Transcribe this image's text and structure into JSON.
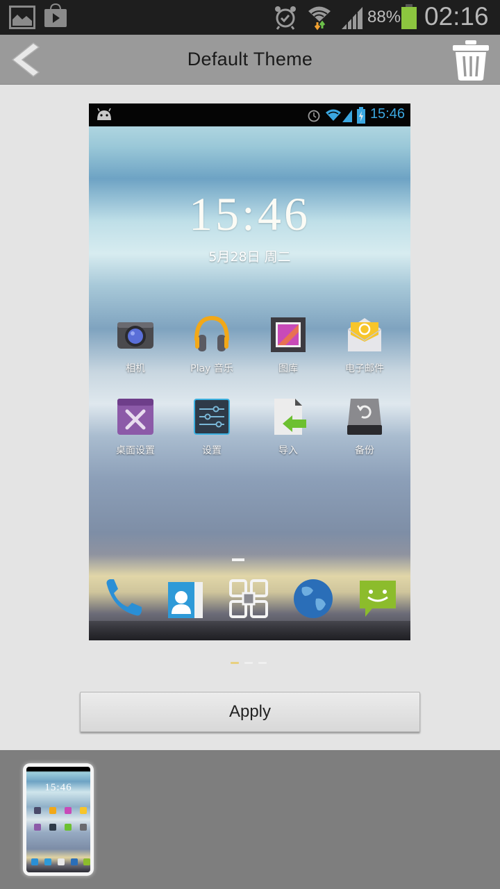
{
  "status_bar": {
    "left_icons": [
      "gallery-icon",
      "play-store-icon"
    ],
    "right_icons": [
      "alarm-icon",
      "wifi-icon",
      "signal-icon",
      "battery-icon"
    ],
    "battery_percent": "88%",
    "battery_level": 0.88,
    "time": "02:16",
    "battery_color": "#8cc63f"
  },
  "action_bar": {
    "back_icon": "back-chevron-icon",
    "title": "Default Theme",
    "delete_icon": "trash-icon"
  },
  "preview": {
    "status_time": "15:46",
    "status_icons": [
      "android-icon",
      "alarm-icon",
      "wifi-icon",
      "signal-icon",
      "battery-charging-icon"
    ],
    "clock": "15:46",
    "date": "5月28日 周二",
    "apps_row1": [
      {
        "label": "相机",
        "icon": "camera-icon"
      },
      {
        "label": "Play 音乐",
        "icon": "headphones-icon"
      },
      {
        "label": "图库",
        "icon": "gallery-icon"
      },
      {
        "label": "电子邮件",
        "icon": "email-icon"
      }
    ],
    "apps_row2": [
      {
        "label": "桌面设置",
        "icon": "tools-icon"
      },
      {
        "label": "设置",
        "icon": "settings-sliders-icon"
      },
      {
        "label": "导入",
        "icon": "import-icon"
      },
      {
        "label": "备份",
        "icon": "backup-icon"
      }
    ],
    "dock": [
      "phone-icon",
      "contacts-icon",
      "app-drawer-icon",
      "browser-globe-icon",
      "messaging-icon"
    ],
    "page_indicator": {
      "count": 3,
      "active": 1
    }
  },
  "apply_button": {
    "label": "Apply"
  },
  "thumbnails": [
    {
      "name": "Default Theme",
      "selected": true,
      "clock": "15:46"
    }
  ]
}
